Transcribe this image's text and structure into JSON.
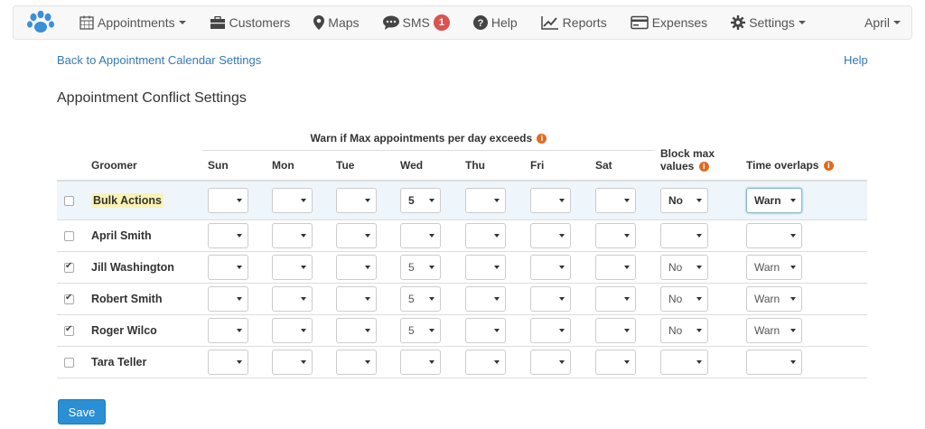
{
  "nav": {
    "items": [
      {
        "label": "Appointments",
        "icon": "calendar-icon",
        "caret": true
      },
      {
        "label": "Customers",
        "icon": "briefcase-icon",
        "caret": false
      },
      {
        "label": "Maps",
        "icon": "map-marker-icon",
        "caret": false
      },
      {
        "label": "SMS",
        "icon": "chat-icon",
        "caret": false,
        "badge": "1"
      },
      {
        "label": "Help",
        "icon": "question-circle-icon",
        "caret": false
      },
      {
        "label": "Reports",
        "icon": "line-chart-icon",
        "caret": false
      },
      {
        "label": "Expenses",
        "icon": "credit-card-icon",
        "caret": false
      },
      {
        "label": "Settings",
        "icon": "gear-icon",
        "caret": true
      }
    ],
    "user": "April"
  },
  "links": {
    "back": "Back to Appointment Calendar Settings",
    "help": "Help"
  },
  "page_title": "Appointment Conflict Settings",
  "table": {
    "group_header": "Warn if Max appointments per day exceeds",
    "columns": {
      "groomer": "Groomer",
      "days": [
        "Sun",
        "Mon",
        "Tue",
        "Wed",
        "Thu",
        "Fri",
        "Sat"
      ],
      "block_line1": "Block max",
      "block_line2": "values",
      "time_overlaps": "Time overlaps"
    },
    "rows": [
      {
        "name": "Bulk Actions",
        "checked": false,
        "days": [
          "",
          "",
          "",
          "5",
          "",
          "",
          ""
        ],
        "block": "No",
        "overlap": "Warn"
      },
      {
        "name": "April Smith",
        "checked": false,
        "days": [
          "",
          "",
          "",
          "",
          "",
          "",
          ""
        ],
        "block": "",
        "overlap": ""
      },
      {
        "name": "Jill Washington",
        "checked": true,
        "days": [
          "",
          "",
          "",
          "5",
          "",
          "",
          ""
        ],
        "block": "No",
        "overlap": "Warn"
      },
      {
        "name": "Robert Smith",
        "checked": true,
        "days": [
          "",
          "",
          "",
          "5",
          "",
          "",
          ""
        ],
        "block": "No",
        "overlap": "Warn"
      },
      {
        "name": "Roger Wilco",
        "checked": true,
        "days": [
          "",
          "",
          "",
          "5",
          "",
          "",
          ""
        ],
        "block": "No",
        "overlap": "Warn"
      },
      {
        "name": "Tara Teller",
        "checked": false,
        "days": [
          "",
          "",
          "",
          "",
          "",
          "",
          ""
        ],
        "block": "",
        "overlap": ""
      }
    ]
  },
  "save_label": "Save",
  "colors": {
    "accent": "#2a8fd3",
    "link": "#337ab7",
    "info": "#e06b1f",
    "badge": "#d9534f"
  }
}
